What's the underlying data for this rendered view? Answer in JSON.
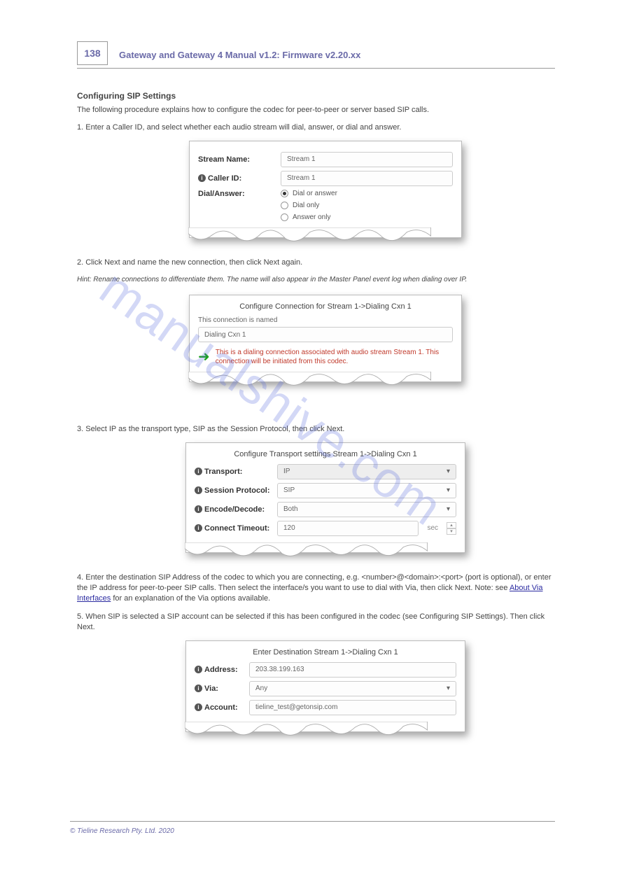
{
  "header": {
    "page_number": "138",
    "title": "Gateway and Gateway 4 Manual v1.2: Firmware v2.20.xx"
  },
  "sec1": {
    "title": "Configuring SIP Settings",
    "intro": "The following procedure explains how to configure the codec for peer-to-peer or server based SIP calls.",
    "step1": "1. Enter a Caller ID, and select whether each audio stream will dial, answer, or dial and answer.",
    "step2": "2. Click Next and name the new connection, then click Next again.",
    "hint": "Hint: Rename connections to differentiate them. The name will also appear in the Master Panel event log when dialing over IP."
  },
  "card1": {
    "stream_name_label": "Stream Name:",
    "stream_name_value": "Stream 1",
    "caller_id_label": "Caller ID:",
    "caller_id_value": "Stream 1",
    "dial_answer_label": "Dial/Answer:",
    "opt_a": "Dial or answer",
    "opt_b": "Dial only",
    "opt_c": "Answer only"
  },
  "card2": {
    "title": "Configure Connection for Stream 1->Dialing Cxn 1",
    "sub": "This connection is named",
    "value": "Dialing Cxn 1",
    "note": "This is a dialing connection associated with audio stream Stream 1. This connection will be initiated from this codec."
  },
  "step3": "3. Select IP as the transport type, SIP as the Session Protocol, then click Next.",
  "card3": {
    "title": "Configure Transport settings Stream 1->Dialing Cxn 1",
    "transport_label": "Transport:",
    "transport_value": "IP",
    "session_label": "Session Protocol:",
    "session_value": "SIP",
    "encode_label": "Encode/Decode:",
    "encode_value": "Both",
    "timeout_label": "Connect Timeout:",
    "timeout_value": "120",
    "timeout_unit": "sec"
  },
  "step4_a": "4. Enter the destination SIP Address of the codec to which you are connecting, e.g. <number>@<domain>:<port> (port is optional), or enter the IP address for peer-to-peer SIP calls. Then select the interface/s you want to use to dial with Via, then click Next. Note: see ",
  "step4_link": "About Via Interfaces",
  "step4_b": " for an explanation of the Via options available.",
  "step5": "5. When SIP is selected a SIP account can be selected if this has been configured in the codec (see Configuring SIP Settings). Then click Next.",
  "card4": {
    "title": "Enter Destination Stream 1->Dialing Cxn 1",
    "addr_label": "Address:",
    "addr_value": "203.38.199.163",
    "via_label": "Via:",
    "via_value": "Any",
    "acct_label": "Account:",
    "acct_value": "tieline_test@getonsip.com"
  },
  "footer": {
    "text": "© Tieline Research Pty. Ltd. 2020"
  },
  "watermark": "manualshive.com"
}
